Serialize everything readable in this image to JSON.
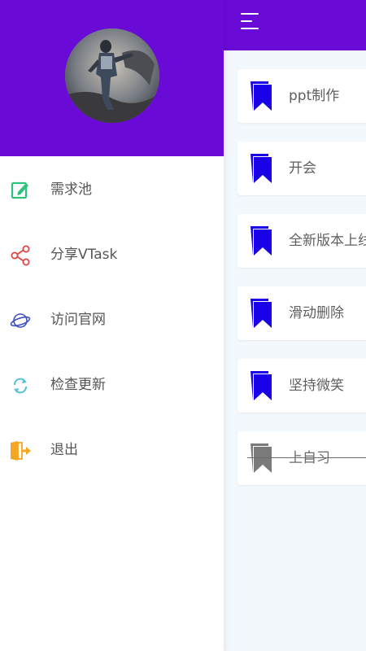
{
  "main": {
    "tasks": [
      {
        "title": "ppt制作",
        "done": false
      },
      {
        "title": "开会",
        "done": false
      },
      {
        "title": "全新版本上线",
        "done": false
      },
      {
        "title": "滑动删除",
        "done": false
      },
      {
        "title": "坚持微笑",
        "done": false
      },
      {
        "title": "上自习",
        "done": true
      }
    ]
  },
  "drawer": {
    "items": [
      {
        "label": "需求池",
        "icon": "edit-icon"
      },
      {
        "label": "分享VTask",
        "icon": "share-icon"
      },
      {
        "label": "访问官网",
        "icon": "planet-icon"
      },
      {
        "label": "检查更新",
        "icon": "refresh-icon"
      },
      {
        "label": "退出",
        "icon": "exit-door-icon"
      }
    ]
  },
  "colors": {
    "primary": "#6a0ad6",
    "bookmark": "#1900e6",
    "bookmark_done": "#7a7a7a",
    "edit_icon": "#2ec27e",
    "share_icon": "#e04545",
    "planet_icon": "#3f51c4",
    "refresh_icon": "#5bc0de",
    "exit_icon": "#f5a623"
  }
}
